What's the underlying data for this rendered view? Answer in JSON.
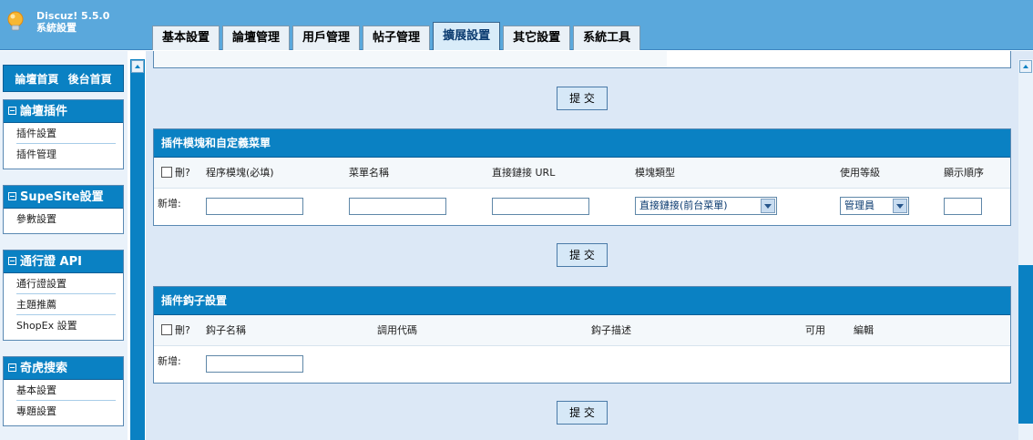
{
  "header": {
    "brand_line1": "Discuz! 5.5.0",
    "brand_line2": "系統設置",
    "tabs": [
      {
        "label": "基本設置",
        "active": false
      },
      {
        "label": "論壇管理",
        "active": false
      },
      {
        "label": "用戶管理",
        "active": false
      },
      {
        "label": "帖子管理",
        "active": false
      },
      {
        "label": "擴展設置",
        "active": true
      },
      {
        "label": "其它設置",
        "active": false
      },
      {
        "label": "系統工具",
        "active": false
      }
    ]
  },
  "sidebar": {
    "home_links": [
      "論壇首頁",
      "後台首頁"
    ],
    "panels": [
      {
        "title": "論壇插件",
        "items": [
          "插件設置",
          "插件管理"
        ]
      },
      {
        "title": "SupeSite設置",
        "items": [
          "參數設置"
        ]
      },
      {
        "title": "通行證 API",
        "items": [
          "通行證設置",
          "主題推薦",
          "ShopEx 設置"
        ]
      },
      {
        "title": "奇虎搜索",
        "items": [
          "基本設置",
          "專題設置"
        ]
      }
    ]
  },
  "main": {
    "submit_label": "提 交",
    "modules_section": {
      "title": "插件模塊和自定義菜單",
      "headers": {
        "delete": "刪?",
        "program_module": "程序模塊(必填)",
        "menu_name": "菜單名稱",
        "direct_url": "直接鏈接 URL",
        "module_type": "模塊類型",
        "usage_level": "使用等級",
        "display_order": "顯示順序"
      },
      "new_label": "新增:",
      "module_type_selected": "直接鏈接(前台菜單)",
      "usage_level_selected": "管理員"
    },
    "hooks_section": {
      "title": "插件鈎子設置",
      "headers": {
        "delete": "刪?",
        "hook_name": "鈎子名稱",
        "call_code": "調用代碼",
        "hook_desc": "鈎子描述",
        "available": "可用",
        "edit": "編輯"
      },
      "new_label": "新增:"
    }
  },
  "colors": {
    "accent": "#0a81c3",
    "header_bg": "#5aa8dc",
    "content_bg": "#dce8f6"
  }
}
